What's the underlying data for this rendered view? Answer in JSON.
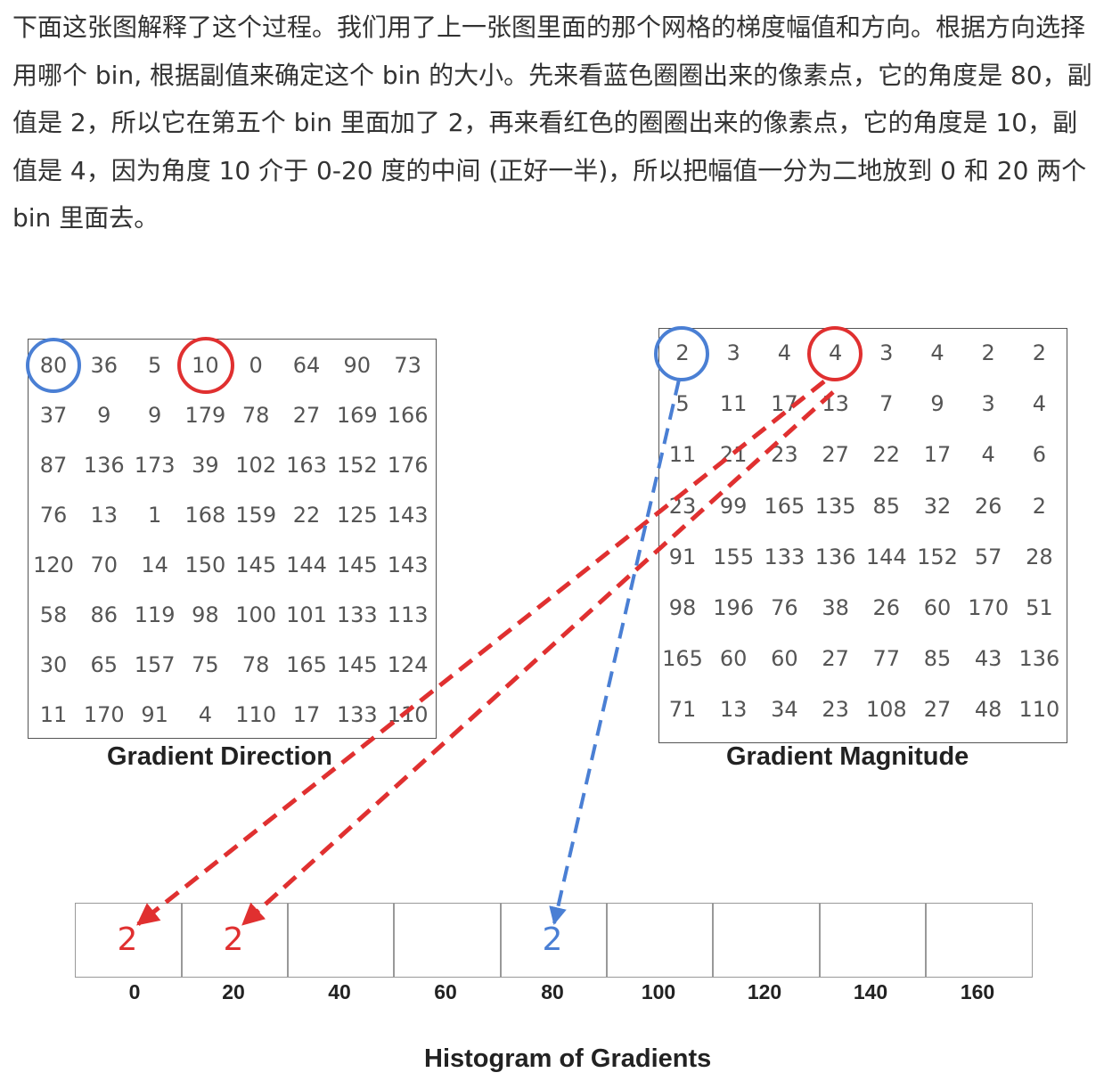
{
  "paragraph": "下面这张图解释了这个过程。我们用了上一张图里面的那个网格的梯度幅值和方向。根据方向选择用哪个 bin, 根据副值来确定这个 bin 的大小。先来看蓝色圈圈出来的像素点，它的角度是 80，副值是 2，所以它在第五个 bin 里面加了 2，再来看红色的圈圈出来的像素点，它的角度是 10，副值是 4，因为角度 10 介于 0-20 度的中间 (正好一半)，所以把幅值一分为二地放到 0 和 20 两个 bin 里面去。",
  "direction": {
    "caption": "Gradient Direction",
    "rows": [
      [
        "80",
        "36",
        "5",
        "10",
        "0",
        "64",
        "90",
        "73"
      ],
      [
        "37",
        "9",
        "9",
        "179",
        "78",
        "27",
        "169",
        "166"
      ],
      [
        "87",
        "136",
        "173",
        "39",
        "102",
        "163",
        "152",
        "176"
      ],
      [
        "76",
        "13",
        "1",
        "168",
        "159",
        "22",
        "125",
        "143"
      ],
      [
        "120",
        "70",
        "14",
        "150",
        "145",
        "144",
        "145",
        "143"
      ],
      [
        "58",
        "86",
        "119",
        "98",
        "100",
        "101",
        "133",
        "113"
      ],
      [
        "30",
        "65",
        "157",
        "75",
        "78",
        "165",
        "145",
        "124"
      ],
      [
        "11",
        "170",
        "91",
        "4",
        "110",
        "17",
        "133",
        "110"
      ]
    ]
  },
  "magnitude": {
    "caption": "Gradient Magnitude",
    "rows": [
      [
        "2",
        "3",
        "4",
        "4",
        "3",
        "4",
        "2",
        "2"
      ],
      [
        "5",
        "11",
        "17",
        "13",
        "7",
        "9",
        "3",
        "4"
      ],
      [
        "11",
        "21",
        "23",
        "27",
        "22",
        "17",
        "4",
        "6"
      ],
      [
        "23",
        "99",
        "165",
        "135",
        "85",
        "32",
        "26",
        "2"
      ],
      [
        "91",
        "155",
        "133",
        "136",
        "144",
        "152",
        "57",
        "28"
      ],
      [
        "98",
        "196",
        "76",
        "38",
        "26",
        "60",
        "170",
        "51"
      ],
      [
        "165",
        "60",
        "60",
        "27",
        "77",
        "85",
        "43",
        "136"
      ],
      [
        "71",
        "13",
        "34",
        "23",
        "108",
        "27",
        "48",
        "110"
      ]
    ]
  },
  "histogram": {
    "caption": "Histogram of Gradients",
    "bins": [
      "0",
      "20",
      "40",
      "60",
      "80",
      "100",
      "120",
      "140",
      "160"
    ],
    "values": [
      "2",
      "2",
      "",
      "",
      "2",
      "",
      "",
      "",
      ""
    ],
    "value_colors": [
      "#e03030",
      "#e03030",
      "",
      "",
      "#4a7fd4",
      "",
      "",
      "",
      ""
    ]
  },
  "colors": {
    "blue": "#4a7fd4",
    "red": "#e03030"
  }
}
